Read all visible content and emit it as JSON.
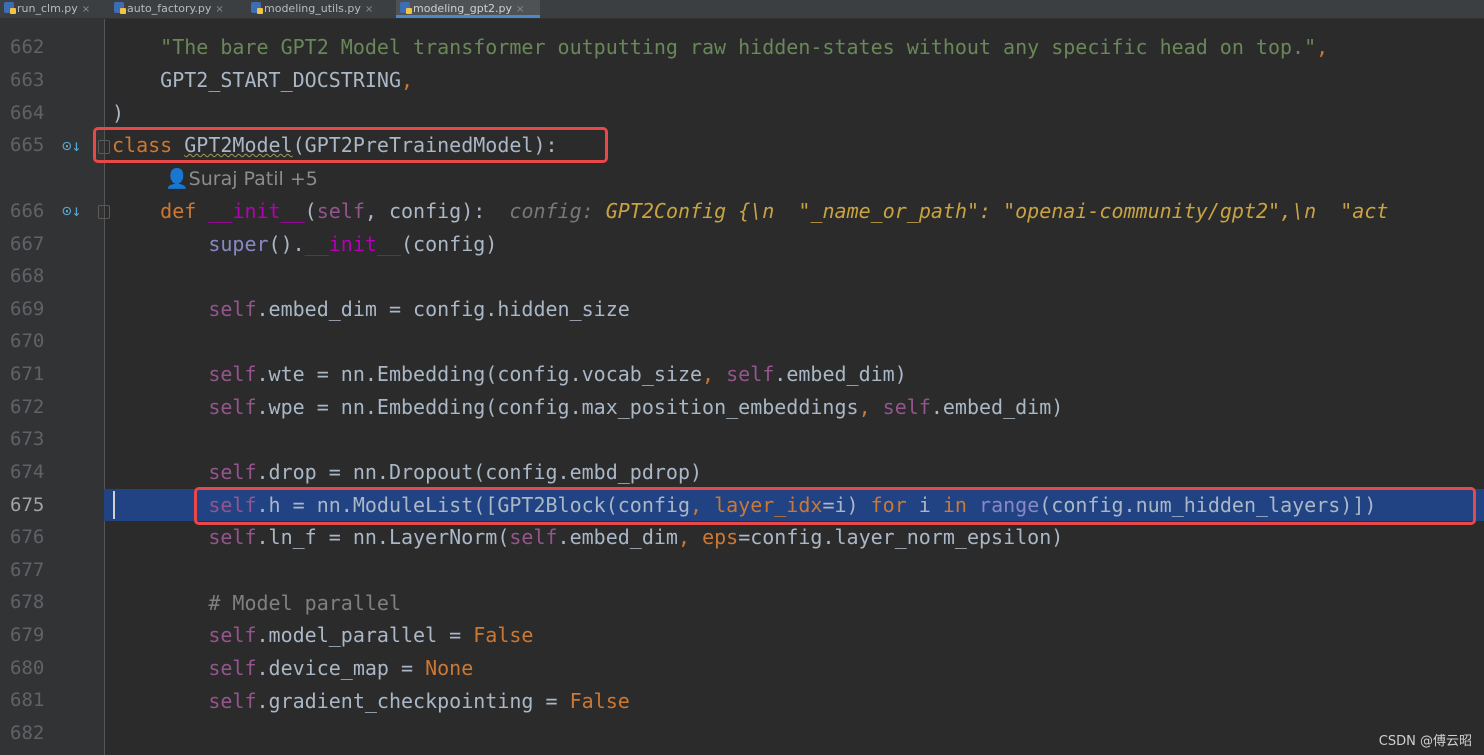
{
  "tabs": [
    {
      "label": "run_clm.py",
      "close": "×"
    },
    {
      "label": "auto_factory.py",
      "close": "×"
    },
    {
      "label": "modeling_utils.py",
      "close": "×"
    },
    {
      "label": "modeling_gpt2.py",
      "close": "×",
      "active": true
    }
  ],
  "line_numbers": [
    "662",
    "663",
    "664",
    "665",
    "666",
    "667",
    "668",
    "669",
    "670",
    "671",
    "672",
    "673",
    "674",
    "675",
    "676",
    "677",
    "678",
    "679",
    "680",
    "681",
    "682"
  ],
  "code": {
    "l662": "\"The bare GPT2 Model transformer outputting raw hidden-states without any specific head on top.\"",
    "l663": "GPT2_START_DOCSTRING",
    "l664": ")",
    "l665_kw": "class",
    "l665_name": "GPT2Model",
    "l665_rest": "(GPT2PreTrainedModel):",
    "author": "Suraj Patil +5",
    "l666_def": "def",
    "l666_init": "__init__",
    "l666_self": "self",
    "l666_rest": ", config):",
    "l666_hint_label": "config:",
    "l666_hint_value": "GPT2Config {\\n  \"_name_or_path\": \"openai-community/gpt2\",\\n  \"act",
    "l667_super": "super",
    "l667_init": "__init__",
    "l669": "embed_dim = config.hidden_size",
    "l671": "wte = nn.Embedding(config.vocab_size",
    "l671_b": "embed_dim)",
    "l672": "wpe = nn.Embedding(config.max_position_embeddings",
    "l672_b": "embed_dim)",
    "l674": "drop = nn.Dropout(config.embd_pdrop)",
    "l675_a": "h = nn.ModuleList([GPT2Block(config",
    "l675_param": "layer_idx",
    "l675_b": "=i)",
    "l675_for": "for",
    "l675_i": "i",
    "l675_in": "in",
    "l675_range": "range",
    "l675_c": "(config.num_hidden_layers)])",
    "l676_a": "ln_f = nn.LayerNorm(",
    "l676_b": "embed_dim",
    "l676_param": "eps",
    "l676_c": "=config.layer_norm_epsilon)",
    "l678": "# Model parallel",
    "l679": "model_parallel = ",
    "l679_val": "False",
    "l680": "device_map = ",
    "l680_val": "None",
    "l681": "gradient_checkpointing = ",
    "l681_val": "False",
    "self": "self"
  },
  "watermark": "CSDN @傅云昭"
}
